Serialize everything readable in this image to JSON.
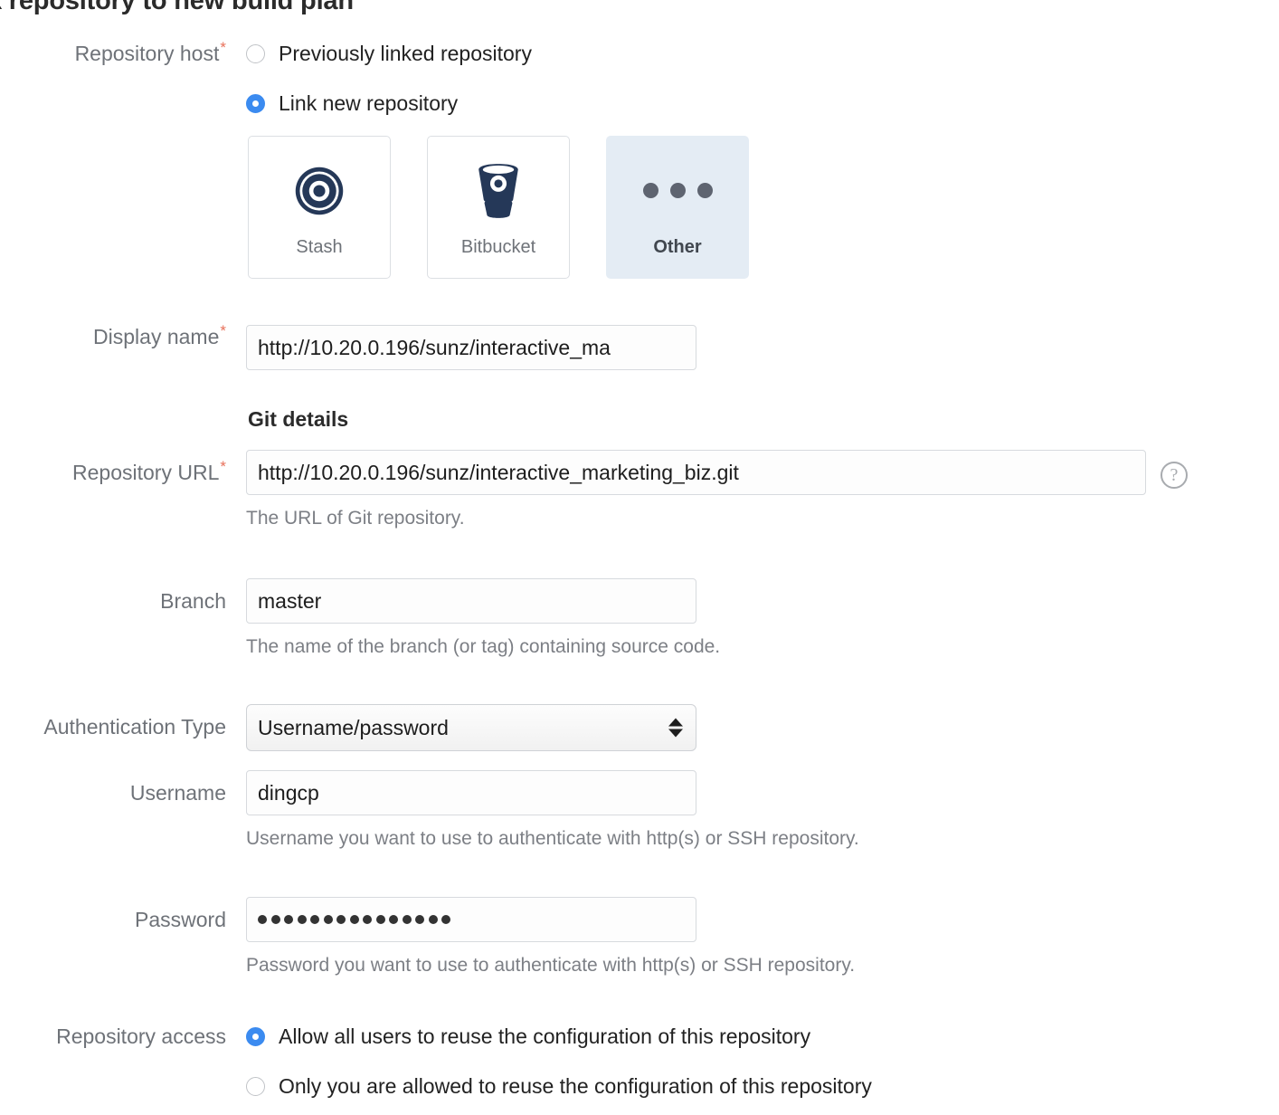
{
  "page": {
    "title": "k repository to new build plan"
  },
  "repository_host": {
    "label": "Repository host",
    "required": true,
    "options": [
      {
        "label": "Previously linked repository",
        "selected": false
      },
      {
        "label": "Link new repository",
        "selected": true
      }
    ],
    "hosts": [
      {
        "name": "Stash",
        "icon": "stash-icon",
        "selected": false
      },
      {
        "name": "Bitbucket",
        "icon": "bitbucket-icon",
        "selected": false
      },
      {
        "name": "Other",
        "icon": "ellipsis-icon",
        "selected": true
      }
    ]
  },
  "display_name": {
    "label": "Display name",
    "required": true,
    "value": "http://10.20.0.196/sunz/interactive_ma"
  },
  "git_details": {
    "heading": "Git details"
  },
  "repository_url": {
    "label": "Repository URL",
    "required": true,
    "value": "http://10.20.0.196/sunz/interactive_marketing_biz.git",
    "hint": "The URL of Git repository.",
    "help_icon": "question-mark-icon"
  },
  "branch": {
    "label": "Branch",
    "value": "master",
    "hint": "The name of the branch (or tag) containing source code."
  },
  "authentication_type": {
    "label": "Authentication Type",
    "value": "Username/password"
  },
  "username": {
    "label": "Username",
    "value": "dingcp",
    "hint": "Username you want to use to authenticate with http(s) or SSH repository."
  },
  "password": {
    "label": "Password",
    "masked_length": 15,
    "hint": "Password you want to use to authenticate with http(s) or SSH repository."
  },
  "repository_access": {
    "label": "Repository access",
    "options": [
      {
        "label": "Allow all users to reuse the configuration of this repository",
        "selected": true
      },
      {
        "label": "Only you are allowed to reuse the configuration of this repository",
        "selected": false
      }
    ]
  },
  "colors": {
    "accent_blue": "#3b8bf0",
    "brand_navy": "#253858",
    "required_red": "#e8705a",
    "label_gray": "#6e7278",
    "selected_card_bg": "#e4ecf4"
  }
}
